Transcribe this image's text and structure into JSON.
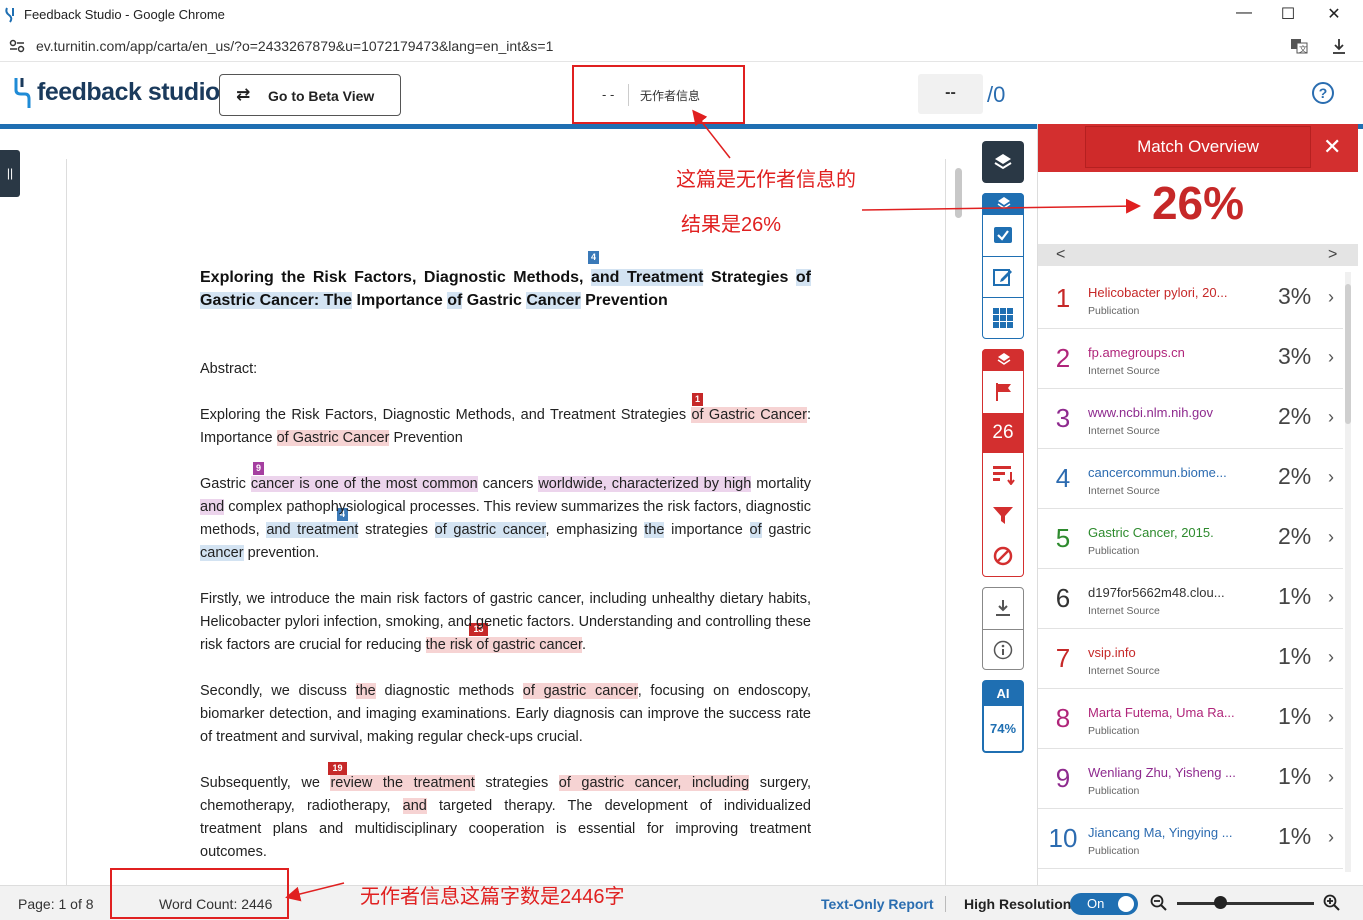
{
  "browser": {
    "window_title": "Feedback Studio - Google Chrome",
    "url": "ev.turnitin.com/app/carta/en_us/?o=2433267879&u=1072179473&lang=en_int&s=1",
    "minimize": "—",
    "maximize": "☐",
    "close": "✕"
  },
  "header": {
    "logo_text": "feedback studio",
    "beta_button": "Go to Beta View",
    "author_dash": "- -",
    "author_name": "无作者信息",
    "grade": "--",
    "grade_total": "/0",
    "help": "?"
  },
  "document": {
    "title_line1_a": "Exploring the Risk Factors, Diagnostic Methods,",
    "title_line1_b": "and Treatment",
    "title_line1_c": "Strategies",
    "title_line1_d": "of",
    "title_line2_a": "Gastric Cancer: The",
    "title_line2_b": "Importance",
    "title_line2_c": "of",
    "title_line2_d": "Gastric",
    "title_line2_e": "Cancer",
    "title_line2_f": "Prevention",
    "abstract_label": "Abstract:",
    "p1_a": "Exploring the Risk Factors, Diagnostic Methods, and Treatment Strategies",
    "p1_b": "of Gastric Cancer",
    "p1_c": ": Importance",
    "p1_d": "of Gastric Cancer",
    "p1_e": "Prevention",
    "p2_a": "Gastric",
    "p2_b": "cancer is one of the most common",
    "p2_c": "cancers",
    "p2_d": "worldwide, characterized by high",
    "p2_e": "mortality",
    "p2_f": "and",
    "p2_g": "complex pathophysiological processes. This review summarizes the risk factors, diagnostic methods,",
    "p2_h": "and treatment",
    "p2_i": "strategies",
    "p2_j": "of gastric cancer",
    "p2_k": ", emphasizing",
    "p2_l": "the",
    "p2_m": "importance",
    "p2_n": "of",
    "p2_o": "gastric",
    "p2_p": "cancer",
    "p2_q": "prevention.",
    "p3_a": "Firstly, we introduce the main risk factors of gastric cancer, including unhealthy dietary habits, Helicobacter pylori infection, smoking, and genetic factors. Understanding and controlling these risk factors are crucial for reducing",
    "p3_b": "the risk of gastric cancer",
    "p3_c": ".",
    "p4_a": "Secondly, we discuss",
    "p4_b": "the",
    "p4_c": "diagnostic methods",
    "p4_d": "of gastric cancer",
    "p4_e": ", focusing on endoscopy, biomarker detection, and imaging examinations. Early diagnosis can improve the success rate of treatment and survival, making regular check-ups crucial.",
    "p5_a": "Subsequently, we",
    "p5_b": "review the treatment",
    "p5_c": "strategies",
    "p5_d": "of gastric cancer, including",
    "p5_e": "surgery, chemotherapy, radiotherapy,",
    "p5_f": "and",
    "p5_g": "targeted therapy. The development of individualized treatment plans and multidisciplinary cooperation is essential for improving treatment outcomes.",
    "tags": {
      "t4a": "4",
      "t1": "1",
      "t9": "9",
      "t4b": "4",
      "t13": "13",
      "t19": "19"
    }
  },
  "tools": {
    "match_count": "26",
    "ai_label": "AI",
    "ai_percent": "74%"
  },
  "panel": {
    "title": "Match Overview",
    "close": "✕",
    "overall": "26%",
    "prev": "<",
    "next": ">",
    "matches": [
      {
        "num": "1",
        "source": "Helicobacter pylori, 20...",
        "type": "Publication",
        "percent": "3%",
        "color": "#c62828"
      },
      {
        "num": "2",
        "source": "fp.amegroups.cn",
        "type": "Internet Source",
        "percent": "3%",
        "color": "#b0257a"
      },
      {
        "num": "3",
        "source": "www.ncbi.nlm.nih.gov",
        "type": "Internet Source",
        "percent": "2%",
        "color": "#8e2a8e"
      },
      {
        "num": "4",
        "source": "cancercommun.biome...",
        "type": "Internet Source",
        "percent": "2%",
        "color": "#2c6bb0"
      },
      {
        "num": "5",
        "source": "Gastric Cancer, 2015.",
        "type": "Publication",
        "percent": "2%",
        "color": "#2e8b2e"
      },
      {
        "num": "6",
        "source": "d197for5662m48.clou...",
        "type": "Internet Source",
        "percent": "1%",
        "color": "#333333"
      },
      {
        "num": "7",
        "source": "vsip.info",
        "type": "Internet Source",
        "percent": "1%",
        "color": "#c62828"
      },
      {
        "num": "8",
        "source": "Marta Futema, Uma Ra...",
        "type": "Publication",
        "percent": "1%",
        "color": "#b0257a"
      },
      {
        "num": "9",
        "source": "Wenliang Zhu, Yisheng ...",
        "type": "Publication",
        "percent": "1%",
        "color": "#8e2a8e"
      },
      {
        "num": "10",
        "source": "Jiancang Ma, Yingying ...",
        "type": "Publication",
        "percent": "1%",
        "color": "#2c6bb0"
      }
    ]
  },
  "footer": {
    "page": "Page: 1 of 8",
    "word_count": "Word Count: 2446",
    "text_only": "Text-Only Report",
    "high_res": "High Resolution",
    "toggle": "On"
  },
  "annotations": {
    "a1": "这篇是无作者信息的",
    "a2": "结果是26%",
    "a3": "无作者信息这篇字数是2446字"
  },
  "colors": {
    "brand_blue": "#1f6fb2",
    "match_red": "#d32f2f",
    "annotation_red": "#e02020"
  }
}
